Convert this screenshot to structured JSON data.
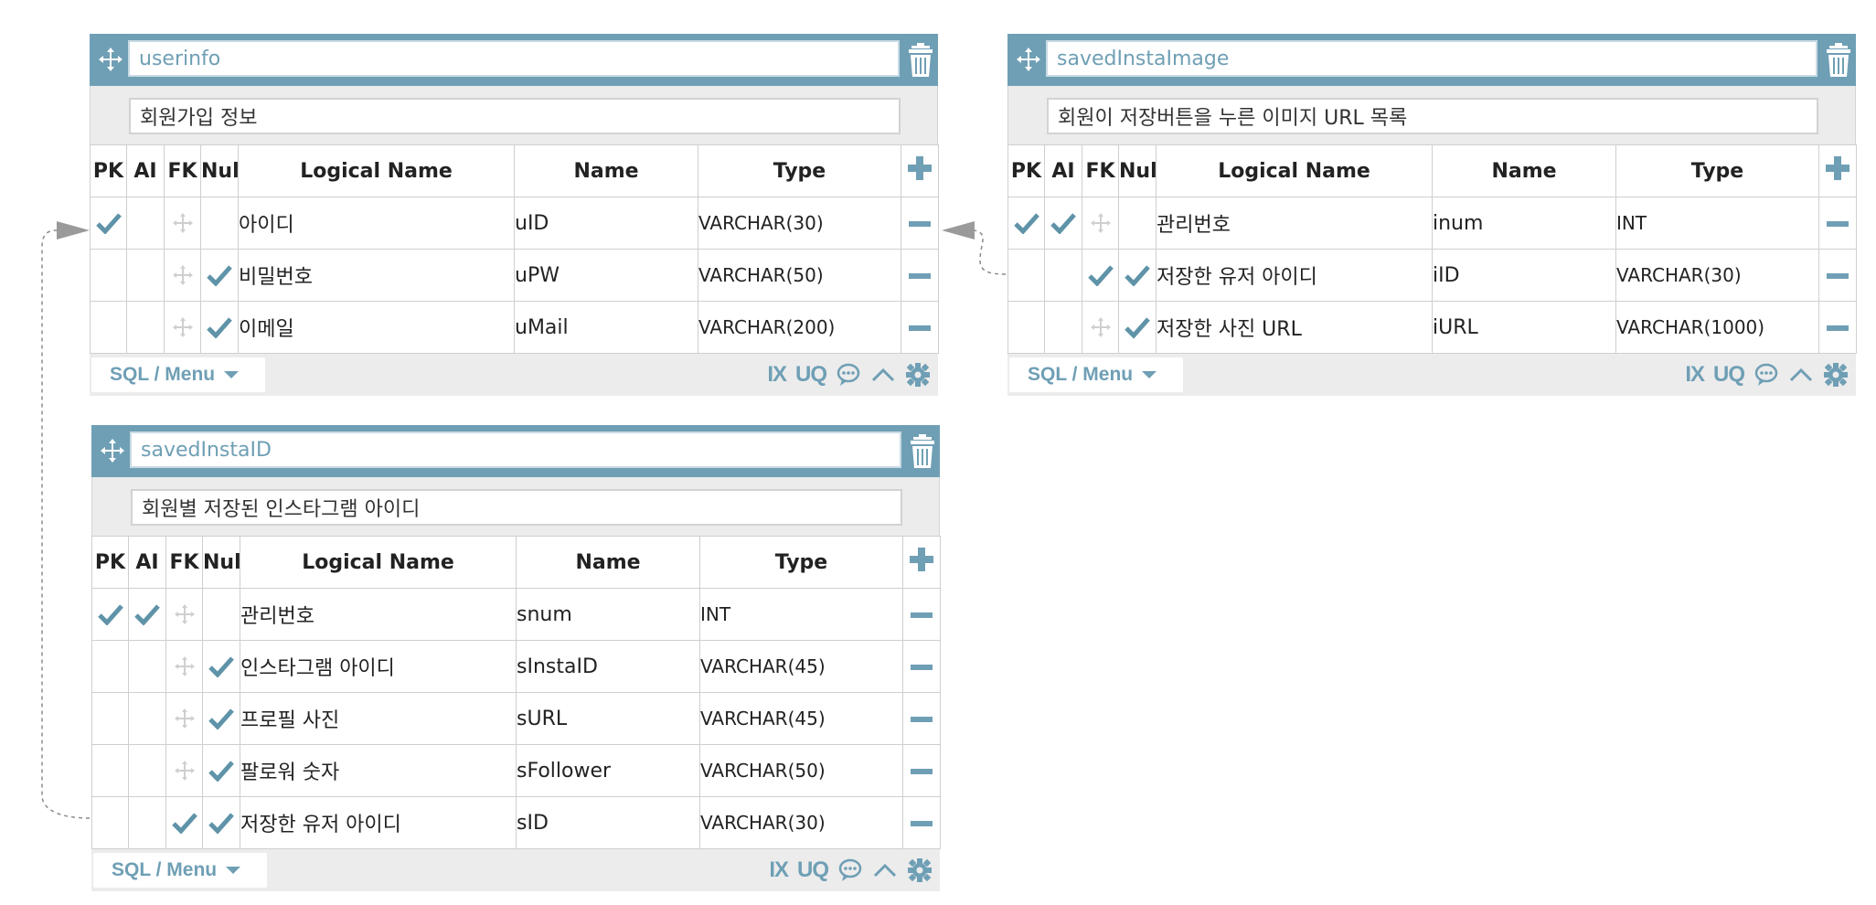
{
  "colors": {
    "accent": "#6f9fb5",
    "check": "#5f93a8",
    "muted": "#c9c9c9"
  },
  "tables": [
    {
      "name": "userinfo",
      "comment": "회원가입 정보",
      "headers": {
        "pk": "PK",
        "ai": "AI",
        "fk": "FK",
        "nul": "Null",
        "logical": "Logical Name",
        "name": "Name",
        "type": "Type"
      },
      "columns": [
        {
          "pk": true,
          "ai": false,
          "fk": false,
          "nul": false,
          "logical": "아이디",
          "name": "uID",
          "type": "VARCHAR(30)"
        },
        {
          "pk": false,
          "ai": false,
          "fk": false,
          "nul": true,
          "logical": "비밀번호",
          "name": "uPW",
          "type": "VARCHAR(50)"
        },
        {
          "pk": false,
          "ai": false,
          "fk": false,
          "nul": true,
          "logical": "이메일",
          "name": "uMail",
          "type": "VARCHAR(200)"
        }
      ],
      "footer": {
        "menu_label": "SQL / Menu",
        "ix": "IX",
        "uq": "UQ"
      }
    },
    {
      "name": "savedInstaImage",
      "comment": "회원이 저장버튼을 누른 이미지 URL 목록",
      "headers": {
        "pk": "PK",
        "ai": "AI",
        "fk": "FK",
        "nul": "Null",
        "logical": "Logical Name",
        "name": "Name",
        "type": "Type"
      },
      "columns": [
        {
          "pk": true,
          "ai": true,
          "fk": false,
          "nul": false,
          "logical": "관리번호",
          "name": "inum",
          "type": "INT"
        },
        {
          "pk": false,
          "ai": false,
          "fk": true,
          "nul": true,
          "logical": "저장한 유저 아이디",
          "name": "iID",
          "type": "VARCHAR(30)"
        },
        {
          "pk": false,
          "ai": false,
          "fk": false,
          "nul": true,
          "logical": "저장한 사진 URL",
          "name": "iURL",
          "type": "VARCHAR(1000)"
        }
      ],
      "footer": {
        "menu_label": "SQL / Menu",
        "ix": "IX",
        "uq": "UQ"
      }
    },
    {
      "name": "savedInstaID",
      "comment": "회원별 저장된 인스타그램 아이디",
      "headers": {
        "pk": "PK",
        "ai": "AI",
        "fk": "FK",
        "nul": "Null",
        "logical": "Logical Name",
        "name": "Name",
        "type": "Type"
      },
      "columns": [
        {
          "pk": true,
          "ai": true,
          "fk": false,
          "nul": false,
          "logical": "관리번호",
          "name": "snum",
          "type": "INT"
        },
        {
          "pk": false,
          "ai": false,
          "fk": false,
          "nul": true,
          "logical": "인스타그램 아이디",
          "name": "sInstaID",
          "type": "VARCHAR(45)"
        },
        {
          "pk": false,
          "ai": false,
          "fk": false,
          "nul": true,
          "logical": "프로필 사진",
          "name": "sURL",
          "type": "VARCHAR(45)"
        },
        {
          "pk": false,
          "ai": false,
          "fk": false,
          "nul": true,
          "logical": "팔로워 숫자",
          "name": "sFollower",
          "type": "VARCHAR(50)"
        },
        {
          "pk": false,
          "ai": false,
          "fk": true,
          "nul": true,
          "logical": "저장한 유저 아이디",
          "name": "sID",
          "type": "VARCHAR(30)"
        }
      ],
      "footer": {
        "menu_label": "SQL / Menu",
        "ix": "IX",
        "uq": "UQ"
      }
    }
  ],
  "relations": [
    {
      "from_table": "savedInstaImage",
      "from_column": "iID",
      "to_table": "userinfo",
      "to_column": "uID"
    },
    {
      "from_table": "savedInstaID",
      "from_column": "sID",
      "to_table": "userinfo",
      "to_column": "uID"
    }
  ]
}
